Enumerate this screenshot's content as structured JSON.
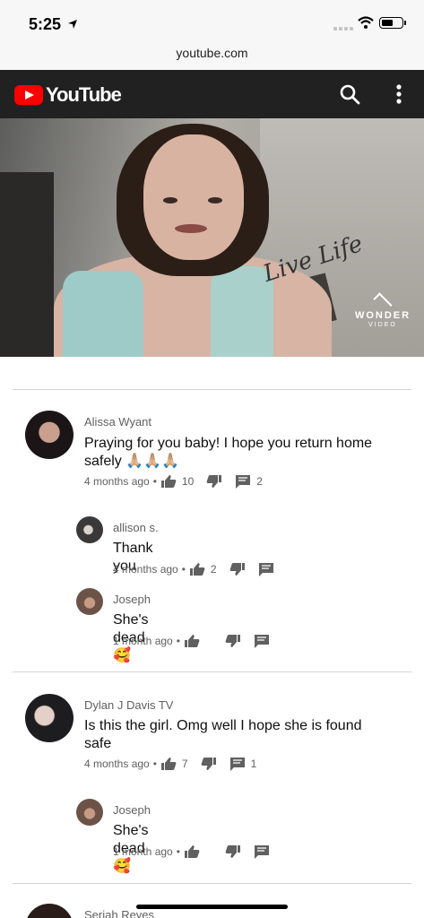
{
  "status_bar": {
    "time": "5:25"
  },
  "browser": {
    "url": "youtube.com"
  },
  "header": {
    "logo_text": "YouTube"
  },
  "video": {
    "overlay_text": "Live Life",
    "watermark_name": "WONDER",
    "watermark_sub": "VIDEO"
  },
  "comments": [
    {
      "author": "Alissa Wyant",
      "text_line1": "Praying for you baby! I hope you return home",
      "text_line2": "safely 🙏🏼🙏🏼🙏🏼",
      "time": "4 months ago",
      "likes": "10",
      "replies": "2"
    },
    {
      "author": "allison s.",
      "text": "Thank you",
      "time": "4 months ago",
      "likes": "2"
    },
    {
      "author": "Joseph",
      "text": "She's dead 🥰",
      "time": "1 month ago"
    },
    {
      "author": "Dylan J Davis TV",
      "text_line1": "Is this the girl. Omg well I hope she is found",
      "text_line2": "safe",
      "time": "4 months ago",
      "likes": "7",
      "replies": "1"
    },
    {
      "author": "Joseph",
      "text": "She's dead 🥰",
      "time": "1 month ago"
    },
    {
      "author": "Seriah Reyes"
    }
  ],
  "icons": {
    "like": "thumb-up-icon",
    "dislike": "thumb-down-icon",
    "reply": "comment-icon",
    "search": "search-icon",
    "more": "more-vert-icon"
  },
  "colors": {
    "youtube_red": "#ff0000",
    "header_bg": "#212121",
    "meta_text": "#606060"
  }
}
